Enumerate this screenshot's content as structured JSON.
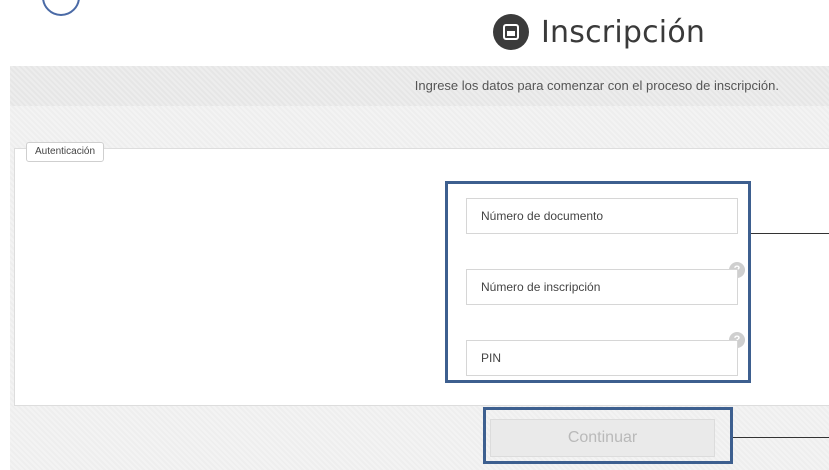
{
  "header": {
    "title": "Inscripción",
    "icon": "id-card-icon"
  },
  "info_band": {
    "text": "Ingrese los datos para comenzar con el proceso de inscripción."
  },
  "form": {
    "legend": "Autenticación",
    "fields": [
      {
        "placeholder": "Número de documento",
        "has_help": false
      },
      {
        "placeholder": "Número de inscripción",
        "has_help": true,
        "help_label": "?"
      },
      {
        "placeholder": "PIN",
        "has_help": true,
        "help_label": "?"
      }
    ],
    "continue_label": "Continuar"
  },
  "colors": {
    "highlight": "#3d5f8f",
    "title_text": "#3a3a3a",
    "button_text_disabled": "#b9b9b9"
  }
}
